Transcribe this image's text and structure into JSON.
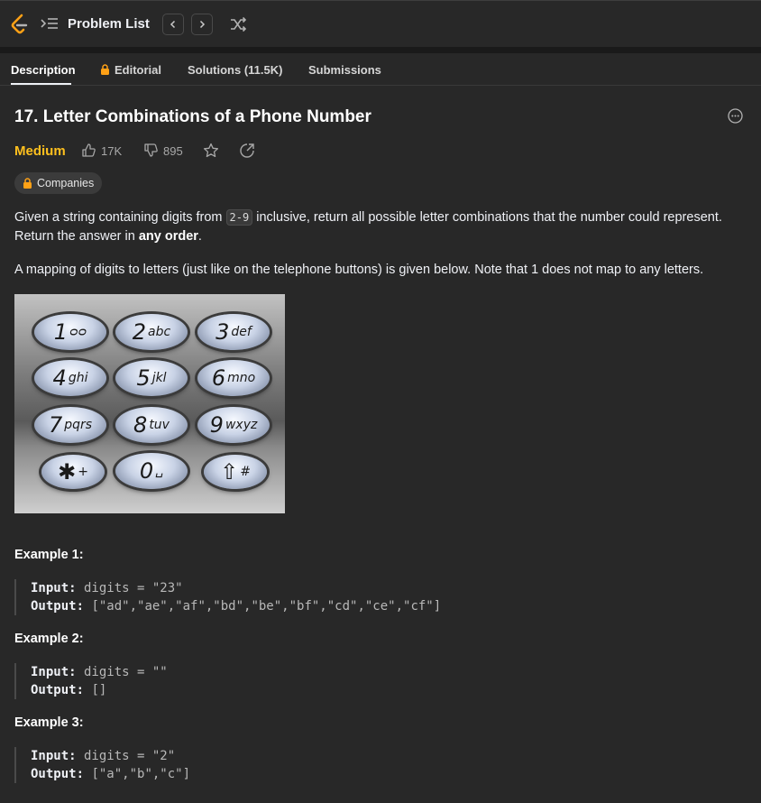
{
  "header": {
    "problem_list_label": "Problem List",
    "icons": [
      "leetcode-logo",
      "list-icon",
      "chevron-left-icon",
      "chevron-right-icon",
      "shuffle-icon"
    ]
  },
  "tabs": [
    {
      "label": "Description",
      "active": true
    },
    {
      "label": "Editorial",
      "locked": true
    },
    {
      "label": "Solutions (11.5K)"
    },
    {
      "label": "Submissions"
    }
  ],
  "problem": {
    "title": "17. Letter Combinations of a Phone Number",
    "difficulty": "Medium",
    "likes": "17K",
    "dislikes": "895",
    "companies_label": "Companies"
  },
  "description": {
    "p1_before": "Given a string containing digits from ",
    "p1_code": "2-9",
    "p1_after": " inclusive, return all possible letter combinations that the number could represent.",
    "p2_before": "Return the answer in ",
    "p2_bold": "any order",
    "p2_after": ".",
    "p3": "A mapping of digits to letters (just like on the telephone buttons) is given below. Note that 1 does not map to any letters."
  },
  "keypad": [
    {
      "num": "1",
      "letters": "ᴑᴑ"
    },
    {
      "num": "2",
      "letters": "abc"
    },
    {
      "num": "3",
      "letters": "def"
    },
    {
      "num": "4",
      "letters": "ghi"
    },
    {
      "num": "5",
      "letters": "jkl"
    },
    {
      "num": "6",
      "letters": "mno"
    },
    {
      "num": "7",
      "letters": "pqrs"
    },
    {
      "num": "8",
      "letters": "tuv"
    },
    {
      "num": "9",
      "letters": "wxyz"
    },
    {
      "num": "✱",
      "letters": "+"
    },
    {
      "num": "0",
      "letters": "␣"
    },
    {
      "num": "⇧",
      "letters": "#"
    }
  ],
  "examples": [
    {
      "title": "Example 1:",
      "input_label": "Input:",
      "input": " digits = \"23\"",
      "output_label": "Output:",
      "output": " [\"ad\",\"ae\",\"af\",\"bd\",\"be\",\"bf\",\"cd\",\"ce\",\"cf\"]"
    },
    {
      "title": "Example 2:",
      "input_label": "Input:",
      "input": " digits = \"\"",
      "output_label": "Output:",
      "output": " []"
    },
    {
      "title": "Example 3:",
      "input_label": "Input:",
      "input": " digits = \"2\"",
      "output_label": "Output:",
      "output": " [\"a\",\"b\",\"c\"]"
    }
  ],
  "colors": {
    "background": "#282828",
    "medium": "#ffc01e",
    "text": "#eff1f6",
    "muted": "#a8a8a8"
  }
}
